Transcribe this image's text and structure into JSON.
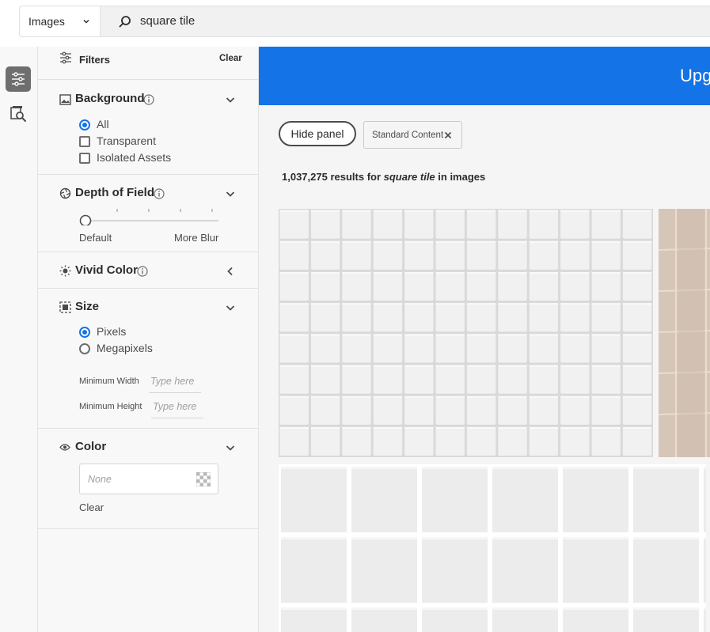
{
  "search": {
    "type_label": "Images",
    "query": "square tile"
  },
  "filters": {
    "title": "Filters",
    "clear_label": "Clear",
    "background": {
      "title": "Background",
      "options": [
        {
          "label": "All",
          "selected": true
        },
        {
          "label": "Transparent",
          "selected": false
        },
        {
          "label": "Isolated Assets",
          "selected": false
        }
      ]
    },
    "depth_of_field": {
      "title": "Depth of Field",
      "min_label": "Default",
      "max_label": "More Blur",
      "level": 0
    },
    "vivid_color": {
      "title": "Vivid Color"
    },
    "size": {
      "title": "Size",
      "options": [
        {
          "label": "Pixels",
          "selected": true
        },
        {
          "label": "Megapixels",
          "selected": false
        }
      ],
      "min_width_label": "Minimum Width",
      "min_width_placeholder": "Type here",
      "min_height_label": "Minimum Height",
      "min_height_placeholder": "Type here"
    },
    "color": {
      "title": "Color",
      "placeholder": "None",
      "clear_label": "Clear"
    }
  },
  "main": {
    "banner_text": "Upg",
    "hide_panel_label": "Hide panel",
    "chip_label": "Standard Content",
    "results": {
      "count": "1,037,275",
      "mid": " results for ",
      "query": "square tile",
      "suffix": " in images"
    }
  },
  "colors": {
    "accent": "#1473e6",
    "banner": "#1473e6",
    "panel_bg": "#f8f8f8"
  },
  "icons": [
    "chevron-down-icon",
    "search-icon",
    "filters-icon",
    "similar-search-icon",
    "image-icon",
    "info-icon",
    "aperture-icon",
    "sun-icon",
    "crop-icon",
    "eye-icon",
    "chevron-left-icon",
    "close-icon",
    "transparency-icon"
  ]
}
